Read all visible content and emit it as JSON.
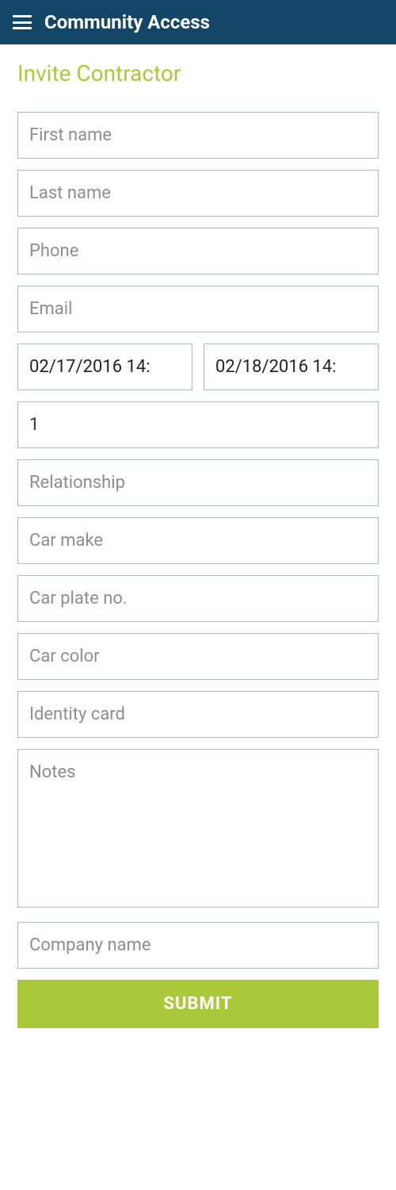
{
  "header": {
    "title": "Community Access"
  },
  "page": {
    "title": "Invite Contractor"
  },
  "form": {
    "first_name": {
      "placeholder": "First name",
      "value": ""
    },
    "last_name": {
      "placeholder": "Last name",
      "value": ""
    },
    "phone": {
      "placeholder": "Phone",
      "value": ""
    },
    "email": {
      "placeholder": "Email",
      "value": ""
    },
    "date_start": {
      "value": "02/17/2016 14:"
    },
    "date_end": {
      "value": "02/18/2016 14:"
    },
    "quantity": {
      "value": "1"
    },
    "relationship": {
      "placeholder": "Relationship",
      "value": ""
    },
    "car_make": {
      "placeholder": "Car make",
      "value": ""
    },
    "car_plate": {
      "placeholder": "Car plate no.",
      "value": ""
    },
    "car_color": {
      "placeholder": "Car color",
      "value": ""
    },
    "identity_card": {
      "placeholder": "Identity card",
      "value": ""
    },
    "notes": {
      "placeholder": "Notes",
      "value": ""
    },
    "company_name": {
      "placeholder": "Company name",
      "value": ""
    },
    "submit_label": "SUBMIT"
  }
}
